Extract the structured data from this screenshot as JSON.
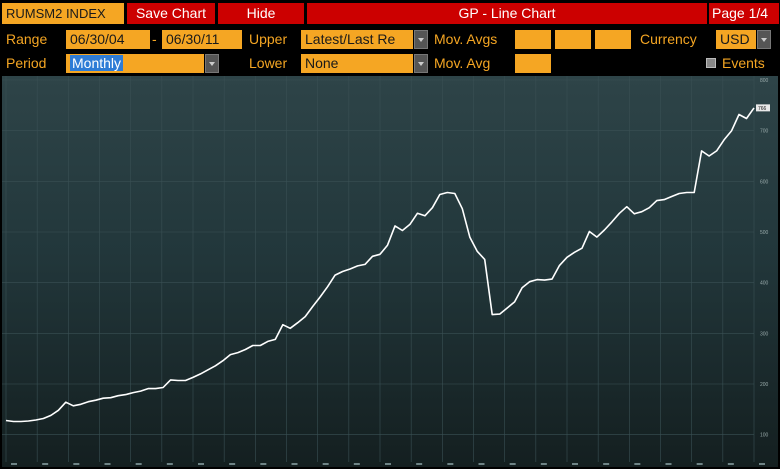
{
  "header": {
    "ticker": "RUMSM2 INDEX",
    "save_chart": "Save Chart",
    "hide": "Hide",
    "title": "GP - Line Chart",
    "page": "Page 1/4"
  },
  "controls": {
    "range_label": "Range",
    "range_start": "06/30/04",
    "range_dash": "-",
    "range_end": "06/30/11",
    "upper_label": "Upper",
    "upper_value": "Latest/Last Re",
    "mov_avgs_label": "Mov. Avgs",
    "currency_label": "Currency",
    "currency_value": "USD",
    "period_label": "Period",
    "period_value": "Monthly",
    "lower_label": "Lower",
    "lower_value": "None",
    "mov_avg_label": "Mov. Avg",
    "events_label": "Events"
  },
  "colors": {
    "accent_orange": "#f5a623",
    "header_red": "#cc0000",
    "line": "#ffffff",
    "background_top": "#263a3f",
    "background_bottom": "#182424"
  },
  "chart_data": {
    "type": "line",
    "ylim": [
      50,
      800
    ],
    "yticks": [
      "100",
      "200",
      "300",
      "400",
      "500",
      "600",
      "700",
      "800"
    ],
    "last_value_label": "766",
    "series": [
      {
        "values": [
          128,
          126,
          126,
          127,
          129,
          132,
          138,
          148,
          164,
          157,
          160,
          165,
          168,
          172,
          173,
          177,
          179,
          183,
          186,
          191,
          191,
          193,
          208,
          207,
          207,
          213,
          220,
          228,
          236,
          246,
          258,
          262,
          268,
          276,
          276,
          284,
          288,
          317,
          310,
          321,
          333,
          353,
          372,
          392,
          415,
          422,
          427,
          433,
          436,
          452,
          456,
          474,
          512,
          503,
          515,
          537,
          532,
          548,
          574,
          578,
          576,
          546,
          490,
          462,
          446,
          337,
          338,
          350,
          362,
          390,
          402,
          406,
          405,
          407,
          434,
          450,
          460,
          468,
          501,
          490,
          504,
          520,
          537,
          550,
          536,
          540,
          548,
          562,
          564,
          570,
          576,
          578,
          578,
          660,
          650,
          660,
          682,
          700,
          732,
          724,
          745
        ]
      }
    ]
  }
}
